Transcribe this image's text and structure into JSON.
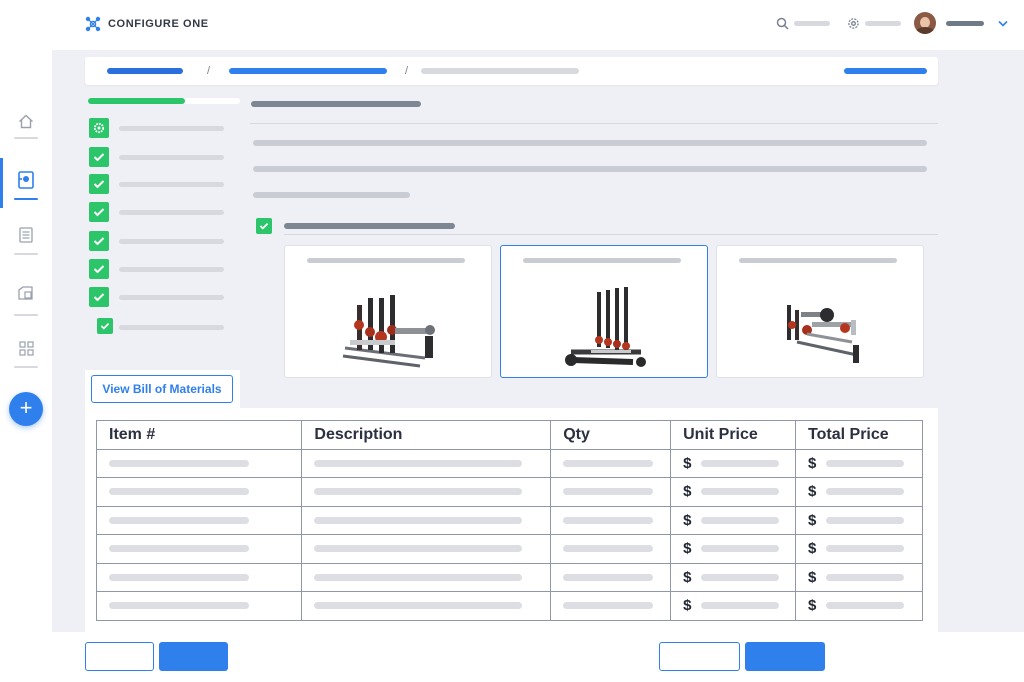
{
  "app": {
    "logo_text": "CONFIGURE ONE"
  },
  "header": {
    "icons": [
      "search-icon",
      "gear-icon",
      "avatar",
      "chevron-down-icon"
    ]
  },
  "sidebar": {
    "items": [
      {
        "icon": "home-icon"
      },
      {
        "icon": "configurator-icon",
        "active": true
      },
      {
        "icon": "document-icon"
      },
      {
        "icon": "catalog-icon"
      },
      {
        "icon": "grid-icon"
      }
    ],
    "add_button_label": "+"
  },
  "bom": {
    "button_label": "View Bill of Materials",
    "columns": [
      "Item #",
      "Description",
      "Qty",
      "Unit Price",
      "Total Price"
    ],
    "currency_symbol": "$",
    "row_count": 6
  },
  "colors": {
    "accent": "#2f80ed",
    "success": "#2dc56a"
  }
}
